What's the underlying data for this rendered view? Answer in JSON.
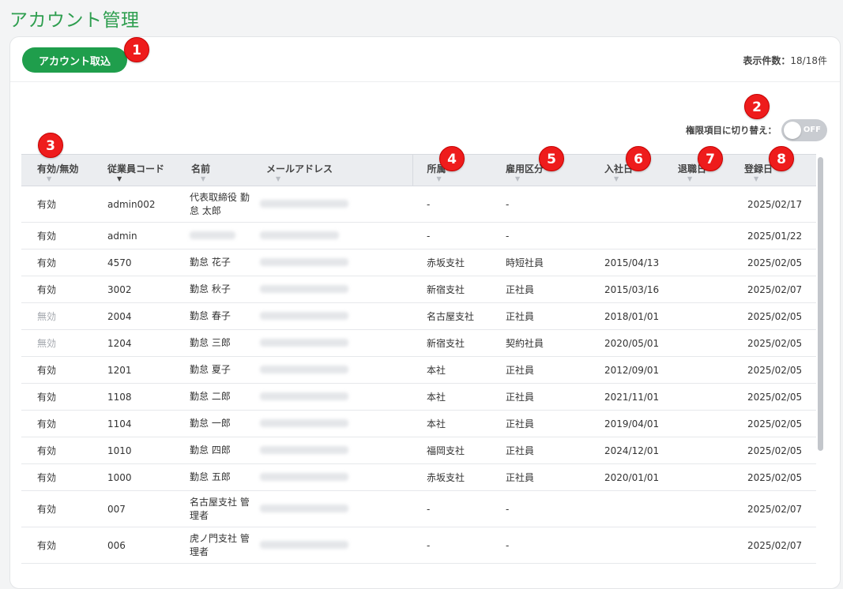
{
  "page": {
    "title": "アカウント管理"
  },
  "toolbar": {
    "import_label": "アカウント取込",
    "count_label": "表示件数：",
    "count_value": "18/18件"
  },
  "permission_toggle": {
    "label": "権限項目に切り替え：",
    "state": "OFF"
  },
  "markers": [
    "1",
    "2",
    "3",
    "4",
    "5",
    "6",
    "7",
    "8"
  ],
  "table": {
    "columns": [
      "有効/無効",
      "従業員コード",
      "名前",
      "メールアドレス",
      "所属",
      "雇用区分",
      "入社日",
      "退職日",
      "登録日"
    ],
    "rows": [
      {
        "status": "有効",
        "code": "admin002",
        "name": "代表取締役 勤怠 太郎",
        "dept": "-",
        "type": "-",
        "joined": "",
        "left": "",
        "registered": "2025/02/17"
      },
      {
        "status": "有効",
        "code": "admin",
        "name": "",
        "dept": "-",
        "type": "-",
        "joined": "",
        "left": "",
        "registered": "2025/01/22"
      },
      {
        "status": "有効",
        "code": "4570",
        "name": "勤怠 花子",
        "dept": "赤坂支社",
        "type": "時短社員",
        "joined": "2015/04/13",
        "left": "",
        "registered": "2025/02/05"
      },
      {
        "status": "有効",
        "code": "3002",
        "name": "勤怠 秋子",
        "dept": "新宿支社",
        "type": "正社員",
        "joined": "2015/03/16",
        "left": "",
        "registered": "2025/02/07"
      },
      {
        "status": "無効",
        "code": "2004",
        "name": "勤怠 春子",
        "dept": "名古屋支社",
        "type": "正社員",
        "joined": "2018/01/01",
        "left": "",
        "registered": "2025/02/05"
      },
      {
        "status": "無効",
        "code": "1204",
        "name": "勤怠 三郎",
        "dept": "新宿支社",
        "type": "契約社員",
        "joined": "2020/05/01",
        "left": "",
        "registered": "2025/02/05"
      },
      {
        "status": "有効",
        "code": "1201",
        "name": "勤怠 夏子",
        "dept": "本社",
        "type": "正社員",
        "joined": "2012/09/01",
        "left": "",
        "registered": "2025/02/05"
      },
      {
        "status": "有効",
        "code": "1108",
        "name": "勤怠 二郎",
        "dept": "本社",
        "type": "正社員",
        "joined": "2021/11/01",
        "left": "",
        "registered": "2025/02/05"
      },
      {
        "status": "有効",
        "code": "1104",
        "name": "勤怠 一郎",
        "dept": "本社",
        "type": "正社員",
        "joined": "2019/04/01",
        "left": "",
        "registered": "2025/02/05"
      },
      {
        "status": "有効",
        "code": "1010",
        "name": "勤怠 四郎",
        "dept": "福岡支社",
        "type": "正社員",
        "joined": "2024/12/01",
        "left": "",
        "registered": "2025/02/05"
      },
      {
        "status": "有効",
        "code": "1000",
        "name": "勤怠 五郎",
        "dept": "赤坂支社",
        "type": "正社員",
        "joined": "2020/01/01",
        "left": "",
        "registered": "2025/02/05"
      },
      {
        "status": "有効",
        "code": "007",
        "name": "名古屋支社 管理者",
        "dept": "-",
        "type": "-",
        "joined": "",
        "left": "",
        "registered": "2025/02/07"
      },
      {
        "status": "有効",
        "code": "006",
        "name": "虎ノ門支社 管理者",
        "dept": "-",
        "type": "-",
        "joined": "",
        "left": "",
        "registered": "2025/02/07"
      }
    ]
  }
}
